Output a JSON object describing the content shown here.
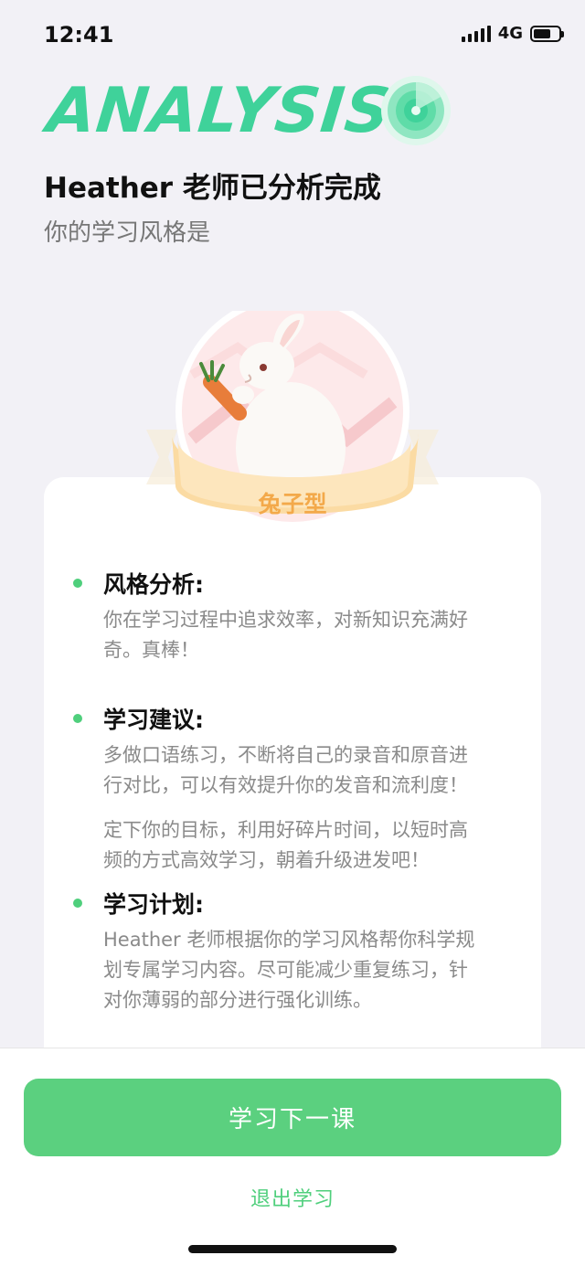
{
  "status_bar": {
    "time": "12:41",
    "network": "4G",
    "battery_level": 0.7
  },
  "header": {
    "analysis_word": "ANALYSIS",
    "title": "Heather 老师已分析完成",
    "subtitle": "你的学习风格是"
  },
  "result": {
    "type_label": "兔子型",
    "sections": [
      {
        "title": "风格分析:",
        "paragraphs": [
          [
            "你在学习过程中追求效率，对新知识充满好",
            "奇。真棒！"
          ]
        ]
      },
      {
        "title": "学习建议:",
        "paragraphs": [
          [
            "多做口语练习，不断将自己的录音和原音进",
            "行对比，可以有效提升你的发音和流利度！"
          ],
          [
            "定下你的目标，利用好碎片时间，以短时高",
            "频的方式高效学习，朝着升级进发吧！"
          ]
        ]
      },
      {
        "title": "学习计划:",
        "paragraphs": [
          [
            "Heather 老师根据你的学习风格帮你科学规",
            "划专属学习内容。尽可能减少重复练习，针",
            "对你薄弱的部分进行强化训练。"
          ]
        ]
      }
    ]
  },
  "actions": {
    "next_label": "学习下一课",
    "exit_label": "退出学习"
  },
  "colors": {
    "accent": "#5bd07f",
    "analysis": "#3fd29a",
    "ribbon": "#f3a94a"
  }
}
